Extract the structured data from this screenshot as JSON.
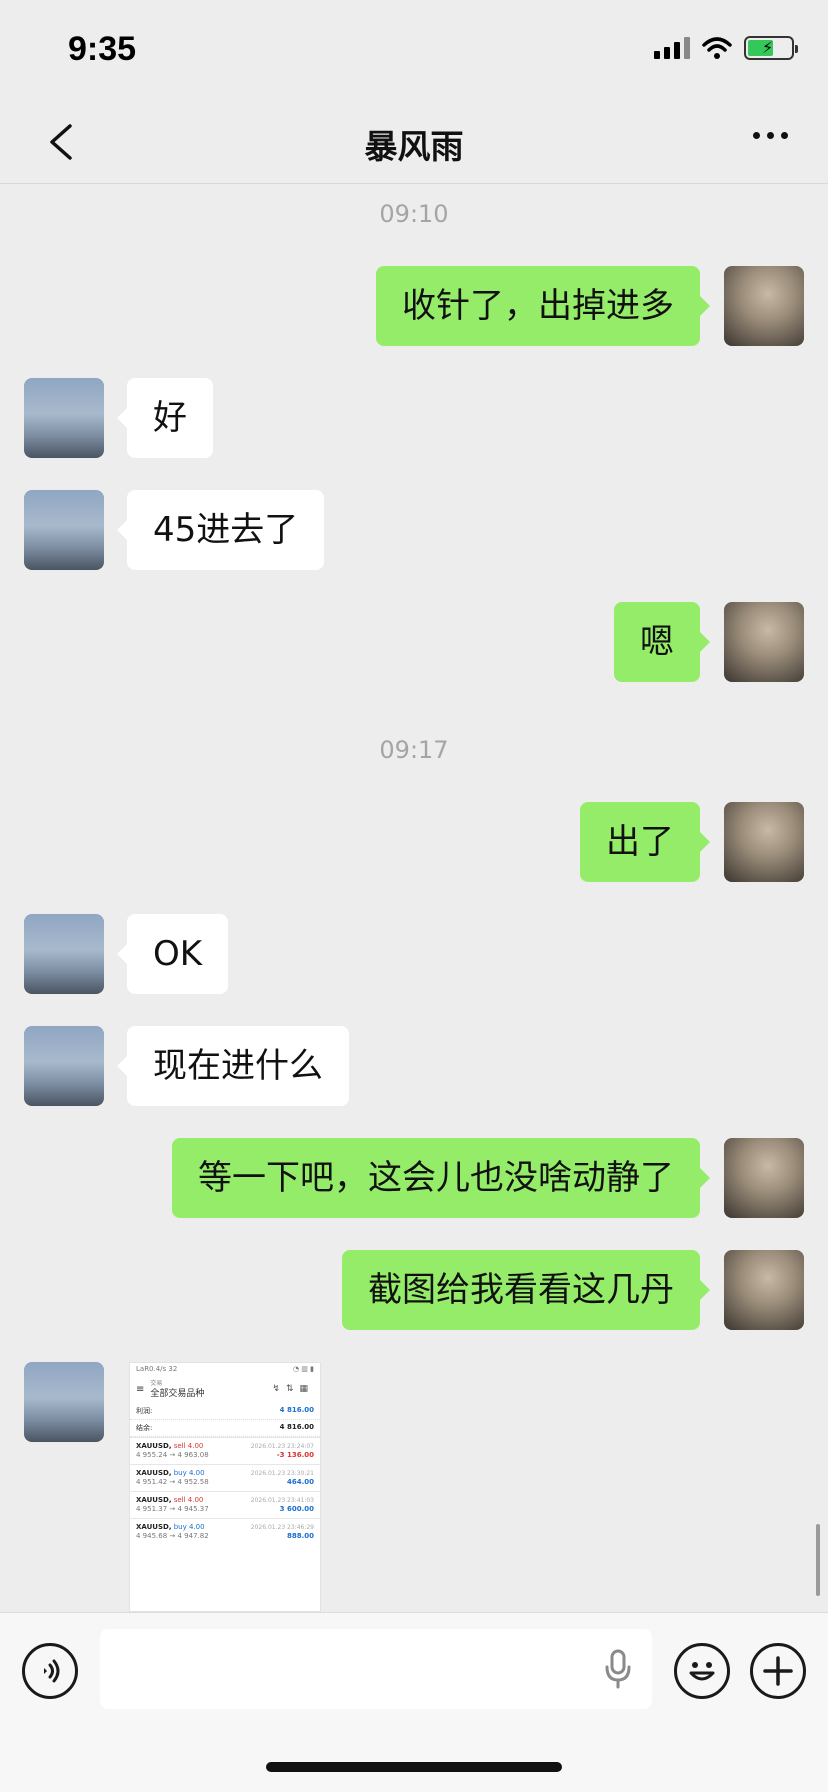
{
  "status_bar": {
    "time": "9:35"
  },
  "header": {
    "title": "暴风雨"
  },
  "timestamps": [
    "09:10",
    "09:17"
  ],
  "messages": [
    {
      "from": "me",
      "text": "收针了，出掉进多"
    },
    {
      "from": "them",
      "text": "好"
    },
    {
      "from": "them",
      "text": "45进去了"
    },
    {
      "from": "me",
      "text": "嗯"
    },
    {
      "from": "me",
      "text": "出了"
    },
    {
      "from": "them",
      "text": "OK"
    },
    {
      "from": "them",
      "text": "现在进什么"
    },
    {
      "from": "me",
      "text": "等一下吧，这会儿也没啥动静了"
    },
    {
      "from": "me",
      "text": "截图给我看看这几丹"
    }
  ],
  "screenshot_message": {
    "status_time": "LaR0.4/s 32",
    "header_small": "交易",
    "header_title": "全部交易品种",
    "profit_label": "利润:",
    "profit_value": "4 816.00",
    "balance_label": "结余:",
    "balance_value": "4 816.00",
    "trades": [
      {
        "symbol": "XAUUSD,",
        "side": "sell 4.00",
        "side_type": "sell",
        "prices": "4 955.24 → 4 963.08",
        "datetime": "2026.01.23 23:24:07",
        "pnl": "-3 136.00",
        "pnl_sign": "neg"
      },
      {
        "symbol": "XAUUSD,",
        "side": "buy 4.00",
        "side_type": "buy",
        "prices": "4 951.42 → 4 952.58",
        "datetime": "2026.01.23 23:30:21",
        "pnl": "464.00",
        "pnl_sign": "pos"
      },
      {
        "symbol": "XAUUSD,",
        "side": "sell 4.00",
        "side_type": "sell",
        "prices": "4 951.37 → 4 945.37",
        "datetime": "2026.01.23 23:41:03",
        "pnl": "3 600.00",
        "pnl_sign": "pos"
      },
      {
        "symbol": "XAUUSD,",
        "side": "buy 4.00",
        "side_type": "buy",
        "prices": "4 945.68 → 4 947.82",
        "datetime": "2026.01.23 23:46:29",
        "pnl": "888.00",
        "pnl_sign": "pos"
      }
    ]
  },
  "colors": {
    "background": "#ededed",
    "my_bubble": "#95ec69",
    "their_bubble": "#ffffff",
    "timestamp_text": "#a5a5a5"
  },
  "icons": [
    "back-icon",
    "more-icon",
    "voice-icon",
    "mic-icon",
    "emoji-icon",
    "plus-icon",
    "signal-icon",
    "wifi-icon",
    "battery-icon"
  ]
}
